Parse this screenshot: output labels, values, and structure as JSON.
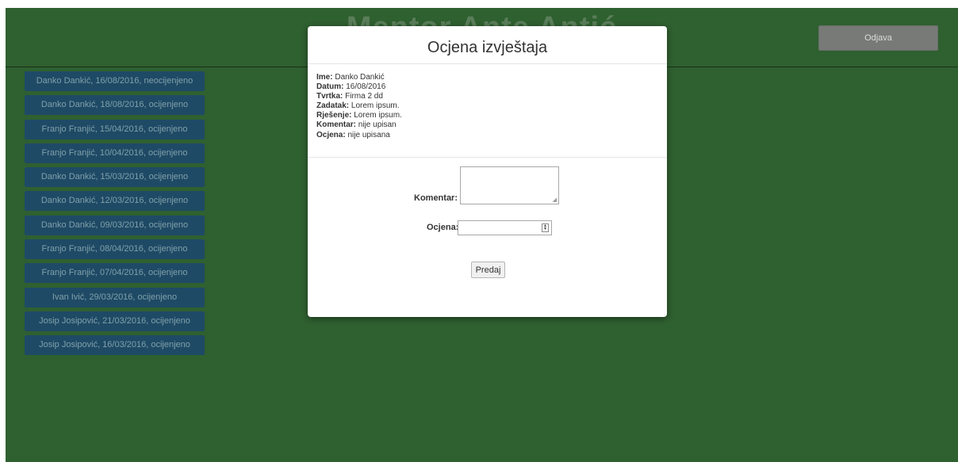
{
  "header": {
    "title": "Mentor Ante Antić",
    "logout_label": "Odjava"
  },
  "reports": [
    {
      "label": "Danko Dankić, 16/08/2016, neocijenjeno"
    },
    {
      "label": "Danko Dankić, 18/08/2016, ocijenjeno"
    },
    {
      "label": "Franjo Franjić, 15/04/2016, ocijenjeno"
    },
    {
      "label": "Franjo Franjić, 10/04/2016, ocijenjeno"
    },
    {
      "label": "Danko Dankić, 15/03/2016, ocijenjeno"
    },
    {
      "label": "Danko Dankić, 12/03/2016, ocijenjeno"
    },
    {
      "label": "Danko Dankić, 09/03/2016, ocijenjeno"
    },
    {
      "label": "Franjo Franjić, 08/04/2016, ocijenjeno"
    },
    {
      "label": "Franjo Franjić, 07/04/2016, ocijenjeno"
    },
    {
      "label": "Ivan Ivić, 29/03/2016, ocijenjeno"
    },
    {
      "label": "Josip Josipović, 21/03/2016, ocijenjeno"
    },
    {
      "label": "Josip Josipović, 16/03/2016, ocijenjeno"
    }
  ],
  "modal": {
    "title": "Ocjena izvještaja",
    "details": [
      {
        "key": "Ime:",
        "value": "Danko Dankić"
      },
      {
        "key": "Datum:",
        "value": "16/08/2016"
      },
      {
        "key": "Tvrtka:",
        "value": "Firma 2 dd"
      },
      {
        "key": "Zadatak:",
        "value": "Lorem ipsum."
      },
      {
        "key": "Rješenje:",
        "value": "Lorem ipsum."
      },
      {
        "key": "Komentar:",
        "value": "nije upisan"
      },
      {
        "key": "Ocjena:",
        "value": "nije upisana"
      }
    ],
    "form": {
      "comment_label": "Komentar:",
      "comment_value": "",
      "rating_label": "Ocjena:",
      "rating_value": "",
      "submit_label": "Predaj"
    }
  },
  "colors": {
    "background": "#2f6030",
    "list_item": "#1f4a66",
    "logout_button": "#777a77"
  }
}
